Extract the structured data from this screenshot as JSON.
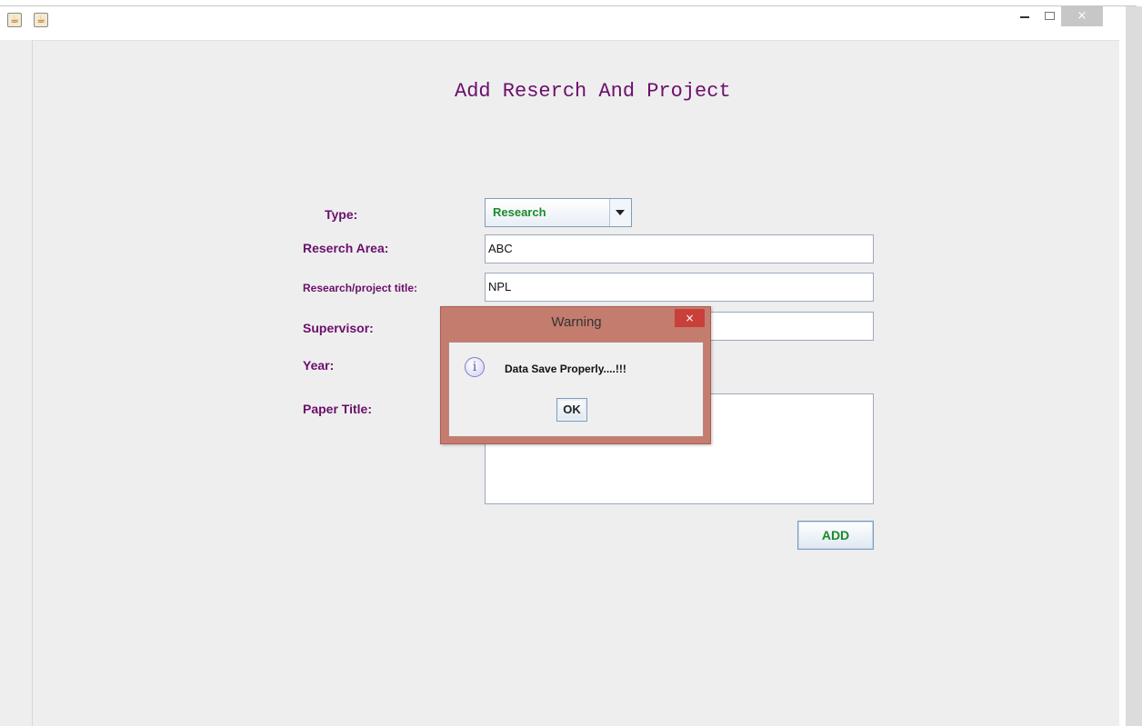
{
  "window": {
    "close_glyph": "×"
  },
  "form": {
    "title": "Add Reserch And Project",
    "type_label": "Type:",
    "type_value": "Research",
    "area_label": "Reserch Area:",
    "area_value": "ABC",
    "title_label": "Research/project title:",
    "title_value": "NPL",
    "supervisor_label": "Supervisor:",
    "supervisor_value": "",
    "year_label": "Year:",
    "paper_title_label": "Paper Title:",
    "paper_title_value": "",
    "add_label": "ADD"
  },
  "dialog": {
    "title": "Warning",
    "close_glyph": "×",
    "info_glyph": "i",
    "message": "Data Save Properly....!!!",
    "ok_label": "OK"
  },
  "colors": {
    "label_purple": "#6b0f6b",
    "accent_green": "#1b8a2a",
    "dialog_frame": "#c47c6e",
    "dialog_close": "#c9403a"
  },
  "icons": [
    "java-app-icon",
    "java-app-icon",
    "minimize-icon",
    "maximize-icon",
    "close-icon",
    "info-icon",
    "dropdown-arrow-icon"
  ]
}
